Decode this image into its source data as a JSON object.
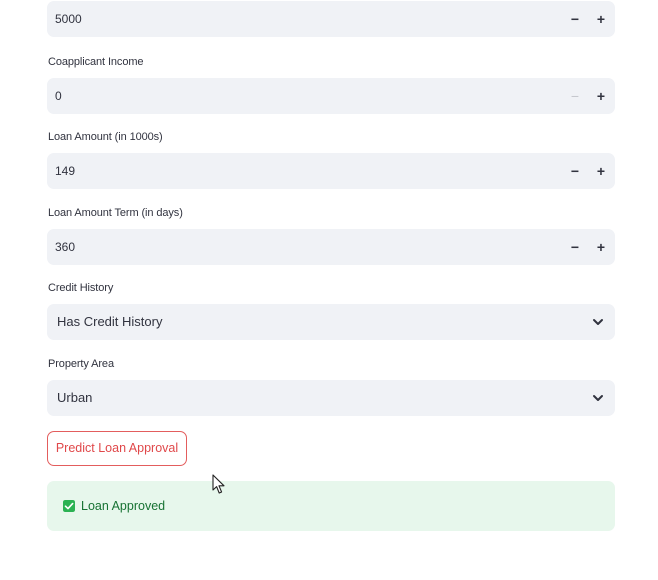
{
  "fields": {
    "applicant_income": {
      "value": "5000"
    },
    "coapplicant_income": {
      "label": "Coapplicant Income",
      "value": "0"
    },
    "loan_amount": {
      "label": "Loan Amount (in 1000s)",
      "value": "149"
    },
    "loan_amount_term": {
      "label": "Loan Amount Term (in days)",
      "value": "360"
    },
    "credit_history": {
      "label": "Credit History",
      "selected": "Has Credit History"
    },
    "property_area": {
      "label": "Property Area",
      "selected": "Urban"
    }
  },
  "stepper": {
    "minus": "−",
    "plus": "+"
  },
  "predict_button": {
    "label": "Predict Loan Approval"
  },
  "result": {
    "message": "Loan Approved",
    "status_color": "#2bb253"
  },
  "icons": {
    "minus": "minus-icon",
    "plus": "plus-icon",
    "dropdown": "chevron-down-icon",
    "success": "checkbox-checked-icon",
    "pointer": "mouse-cursor-icon"
  }
}
